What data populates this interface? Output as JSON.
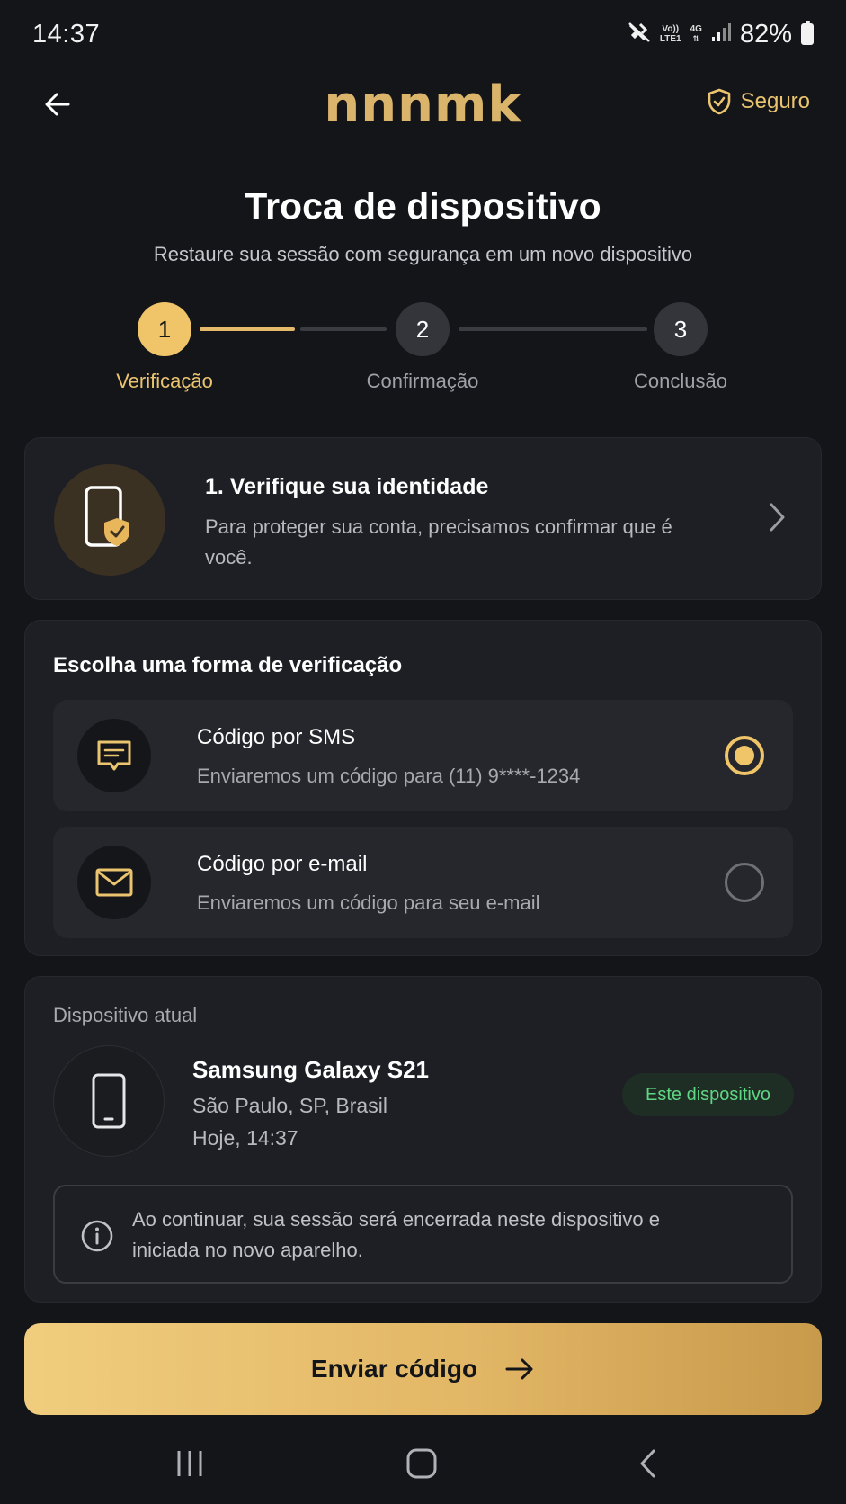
{
  "status_bar": {
    "time": "14:37",
    "network_top": "Vo))",
    "network_bottom": "LTE1",
    "signal_type": "4G",
    "battery": "82%"
  },
  "header": {
    "logo_text": "nnnmk",
    "secure_label": "Seguro"
  },
  "page": {
    "title": "Troca de dispositivo",
    "subtitle": "Restaure sua sessão com segurança em um novo dispositivo"
  },
  "stepper": {
    "steps": [
      {
        "number": "1",
        "label": "Verificação",
        "state": "active"
      },
      {
        "number": "2",
        "label": "Confirmação",
        "state": "inactive"
      },
      {
        "number": "3",
        "label": "Conclusão",
        "state": "inactive"
      }
    ]
  },
  "identity_card": {
    "title": "1. Verifique sua identidade",
    "description": "Para proteger sua conta, precisamos confirmar que é você.",
    "icon": "phone-shield-icon"
  },
  "verification": {
    "title": "Escolha uma forma de verificação",
    "options": [
      {
        "title": "Código por SMS",
        "description": "Enviaremos um código para (11) 9****-1234",
        "icon": "sms-icon",
        "selected": true
      },
      {
        "title": "Código por e-mail",
        "description": "Enviaremos um código para seu e-mail",
        "icon": "mail-icon",
        "selected": false
      }
    ]
  },
  "device": {
    "label": "Dispositivo atual",
    "name": "Samsung Galaxy S21",
    "location": "São Paulo, SP, Brasil",
    "time": "Hoje, 14:37",
    "badge": "Este dispositivo",
    "info": "Ao continuar, sua sessão será encerrada neste dispositivo e iniciada no novo aparelho."
  },
  "primary_button": {
    "label": "Enviar código"
  },
  "colors": {
    "background": "#141519",
    "card": "#1d1f24",
    "accent_gold": "#f0c56a",
    "success_green": "#5fd684"
  }
}
